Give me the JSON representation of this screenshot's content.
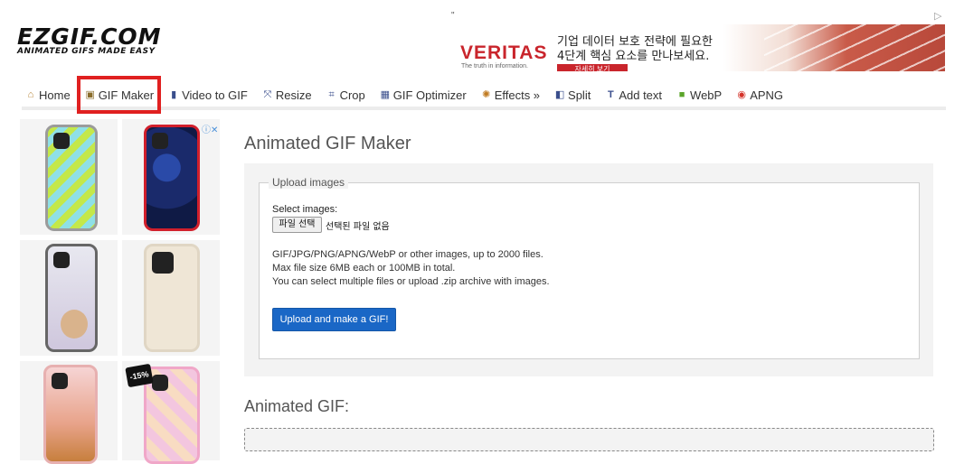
{
  "logo": {
    "main": "EZGIF.COM",
    "tagline": "ANIMATED GIFS MADE EASY"
  },
  "top_ad": {
    "quote_mark": "\"",
    "choice_icon": "ad-choices-icon",
    "brand": "VERITAS",
    "tagline": "The truth in information.",
    "line1": "기업 데이터 보호 전략에 필요한",
    "line2": "4단계 핵심 요소를 만나보세요.",
    "button": "자세히 보기"
  },
  "nav": {
    "items": [
      {
        "label": "Home",
        "icon": "home-icon",
        "glyph": "⌂"
      },
      {
        "label": "GIF Maker",
        "icon": "gif-maker-icon",
        "glyph": "▣"
      },
      {
        "label": "Video to GIF",
        "icon": "video-icon",
        "glyph": "▮"
      },
      {
        "label": "Resize",
        "icon": "resize-icon",
        "glyph": "⤧"
      },
      {
        "label": "Crop",
        "icon": "crop-icon",
        "glyph": "⌗"
      },
      {
        "label": "GIF Optimizer",
        "icon": "optimizer-icon",
        "glyph": "▦"
      },
      {
        "label": "Effects »",
        "icon": "effects-icon",
        "glyph": "✺"
      },
      {
        "label": "Split",
        "icon": "split-icon",
        "glyph": "◧"
      },
      {
        "label": "Add text",
        "icon": "add-text-icon",
        "glyph": "T"
      },
      {
        "label": "WebP",
        "icon": "webp-icon",
        "glyph": "■"
      },
      {
        "label": "APNG",
        "icon": "apng-icon",
        "glyph": "◉"
      }
    ]
  },
  "side_ad": {
    "adchoice": "ⓘ✕",
    "discount": "-15%"
  },
  "main": {
    "title": "Animated GIF Maker",
    "upload": {
      "legend": "Upload images",
      "select_label": "Select images:",
      "file_button": "파일 선택",
      "file_none": "선택된 파일 없음",
      "info1": "GIF/JPG/PNG/APNG/WebP or other images, up to 2000 files.",
      "info2": "Max file size 6MB each or 100MB in total.",
      "info3": "You can select multiple files or upload .zip archive with images.",
      "button": "Upload and make a GIF!"
    },
    "result_title": "Animated GIF:"
  },
  "colors": {
    "highlight": "#e02020",
    "primary_button": "#1a67c6",
    "ad_brand": "#c9252c"
  }
}
